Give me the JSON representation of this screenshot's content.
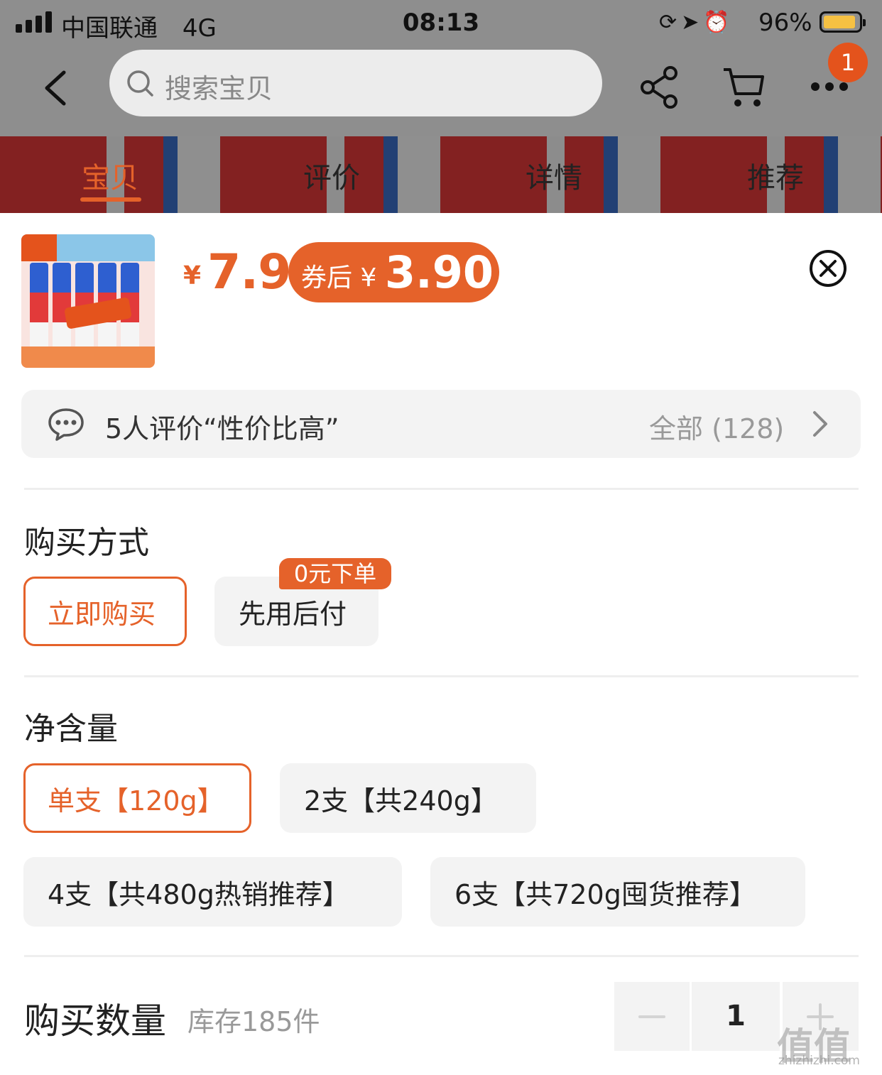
{
  "status_bar": {
    "carrier": "中国联通",
    "network": "4G",
    "time": "08:13",
    "battery_percent": "96%",
    "icons": [
      "orientation-lock-icon",
      "location-icon",
      "alarm-icon"
    ]
  },
  "nav": {
    "search_placeholder": "搜索宝贝",
    "badge_count": "1"
  },
  "tabs": [
    {
      "label": "宝贝",
      "active": true
    },
    {
      "label": "评价",
      "active": false
    },
    {
      "label": "详情",
      "active": false
    },
    {
      "label": "推荐",
      "active": false
    }
  ],
  "product": {
    "currency": "¥",
    "price": "7.9",
    "coupon_label": "券后",
    "coupon_currency": "¥",
    "coupon_price": "3.90"
  },
  "review": {
    "summary": "5人评价“性价比高”",
    "all_label": "全部 (128)"
  },
  "purchase_method": {
    "title": "购买方式",
    "options": [
      {
        "label": "立即购买",
        "selected": true
      },
      {
        "label": "先用后付",
        "selected": false,
        "tag": "0元下单"
      }
    ]
  },
  "net_content": {
    "title": "净含量",
    "options": [
      {
        "label": "单支【120g】",
        "selected": true
      },
      {
        "label": "2支【共240g】",
        "selected": false
      },
      {
        "label": "4支【共480g热销推荐】",
        "selected": false
      },
      {
        "label": "6支【共720g囤货推荐】",
        "selected": false
      }
    ]
  },
  "quantity": {
    "title": "购买数量",
    "stock": "库存185件",
    "value": "1",
    "minus": "−",
    "plus": "+"
  },
  "watermark": {
    "logo": "值值值",
    "domain": "zhizhizhi.com"
  },
  "colors": {
    "accent": "#e5622a",
    "option_bg": "#f3f3f3",
    "overlay": "rgba(0,0,0,0.42)"
  }
}
